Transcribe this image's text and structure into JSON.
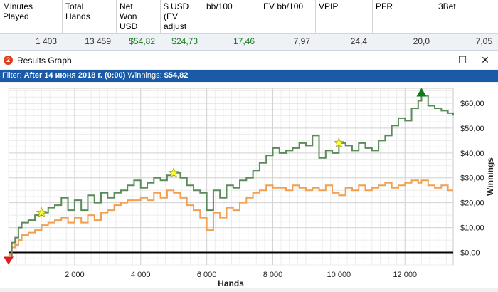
{
  "stats_table": {
    "headers": [
      "Minutes\nPlayed",
      "Total\nHands",
      "Net\nWon\nUSD",
      "$ USD\n(EV\nadjust",
      "bb/100",
      "EV bb/100",
      "VPIP",
      "PFR",
      "3Bet"
    ],
    "values": [
      "1 403",
      "13 459",
      "$54,82",
      "$24,73",
      "17,46",
      "7,97",
      "24,4",
      "20,0",
      "7,05"
    ],
    "value_colors": [
      "#333333",
      "#333333",
      "#1a7a1a",
      "#1a7a1a",
      "#1a7a1a",
      "#333333",
      "#333333",
      "#333333",
      "#333333"
    ]
  },
  "window": {
    "app_icon": "2",
    "title": "Results Graph",
    "minimize": "—",
    "maximize": "☐",
    "close": "✕"
  },
  "filter": {
    "label": "Filter:",
    "value": "After 14 июня 2018 г. (0:00)",
    "winnings_label": "Winnings:",
    "winnings_value": "$54,82"
  },
  "chart_data": {
    "type": "line",
    "xlabel": "Hands",
    "ylabel": "Winnings",
    "xlim": [
      0,
      13459
    ],
    "ylim": [
      -5,
      66
    ],
    "x_ticks": [
      2000,
      4000,
      6000,
      8000,
      10000,
      12000
    ],
    "x_tick_labels": [
      "2 000",
      "4 000",
      "6 000",
      "8 000",
      "10 000",
      "12 000"
    ],
    "y_ticks": [
      0,
      10,
      20,
      30,
      40,
      50,
      60
    ],
    "y_tick_labels": [
      "$0,00",
      "$10,00",
      "$20,00",
      "$30,00",
      "$40,00",
      "$50,00",
      "$60,00"
    ],
    "grid": true,
    "series": [
      {
        "color": "#5b8a5b",
        "x": [
          0,
          100,
          200,
          300,
          400,
          600,
          800,
          1000,
          1200,
          1400,
          1600,
          1800,
          2000,
          2200,
          2400,
          2600,
          2800,
          3000,
          3200,
          3400,
          3600,
          3800,
          4000,
          4200,
          4400,
          4600,
          4800,
          5000,
          5200,
          5400,
          5600,
          5800,
          6000,
          6200,
          6400,
          6600,
          6800,
          7000,
          7200,
          7400,
          7600,
          7800,
          8000,
          8200,
          8400,
          8600,
          8800,
          9000,
          9200,
          9400,
          9600,
          9800,
          10000,
          10200,
          10400,
          10600,
          10800,
          11000,
          11200,
          11400,
          11600,
          11800,
          12000,
          12200,
          12400,
          12500,
          12700,
          12900,
          13100,
          13300,
          13459
        ],
        "y": [
          -2,
          4,
          6,
          10,
          12,
          13,
          15,
          16,
          18,
          19,
          22,
          17,
          21,
          17,
          23,
          20,
          24,
          22,
          24,
          25,
          27,
          29,
          26,
          28,
          30,
          29,
          31,
          32,
          30,
          27,
          25,
          24,
          17,
          25,
          22,
          27,
          26,
          29,
          30,
          33,
          36,
          39,
          42,
          40,
          41,
          42,
          44,
          43,
          47,
          38,
          41,
          40,
          44,
          43,
          41,
          44,
          42,
          41,
          45,
          47,
          51,
          54,
          53,
          58,
          61,
          63,
          59,
          58,
          57,
          56,
          55
        ]
      },
      {
        "color": "#f0a050",
        "x": [
          0,
          100,
          200,
          300,
          400,
          600,
          800,
          1000,
          1200,
          1400,
          1600,
          1800,
          2000,
          2200,
          2400,
          2600,
          2800,
          3000,
          3200,
          3400,
          3600,
          3800,
          4000,
          4200,
          4400,
          4600,
          4800,
          5000,
          5200,
          5400,
          5600,
          5800,
          6000,
          6200,
          6400,
          6600,
          6800,
          7000,
          7200,
          7400,
          7600,
          7800,
          8000,
          8200,
          8400,
          8600,
          8800,
          9000,
          9200,
          9400,
          9600,
          9800,
          10000,
          10200,
          10400,
          10600,
          10800,
          11000,
          11200,
          11400,
          11600,
          11800,
          12000,
          12200,
          12400,
          12500,
          12700,
          12900,
          13100,
          13300,
          13459
        ],
        "y": [
          -1,
          2,
          3,
          5,
          7,
          8,
          9,
          11,
          12,
          13,
          14,
          12,
          14,
          12,
          15,
          13,
          16,
          17,
          19,
          20,
          21,
          21,
          22,
          21,
          24,
          22,
          25,
          24,
          22,
          19,
          17,
          14,
          9,
          16,
          14,
          18,
          17,
          20,
          22,
          24,
          25,
          27,
          26,
          26,
          25,
          27,
          26,
          25,
          26,
          25,
          27,
          24,
          23,
          26,
          25,
          27,
          25,
          26,
          27,
          28,
          26,
          27,
          28,
          29,
          28,
          29,
          27,
          26,
          27,
          25,
          25
        ]
      }
    ],
    "markers": [
      {
        "kind": "star",
        "x": 1000,
        "y": 16
      },
      {
        "kind": "star",
        "x": 5000,
        "y": 32
      },
      {
        "kind": "star",
        "x": 10000,
        "y": 44
      },
      {
        "kind": "peak-triangle",
        "x": 12500,
        "y": 63
      },
      {
        "kind": "low-triangle",
        "x": 0,
        "y": -2
      }
    ]
  }
}
